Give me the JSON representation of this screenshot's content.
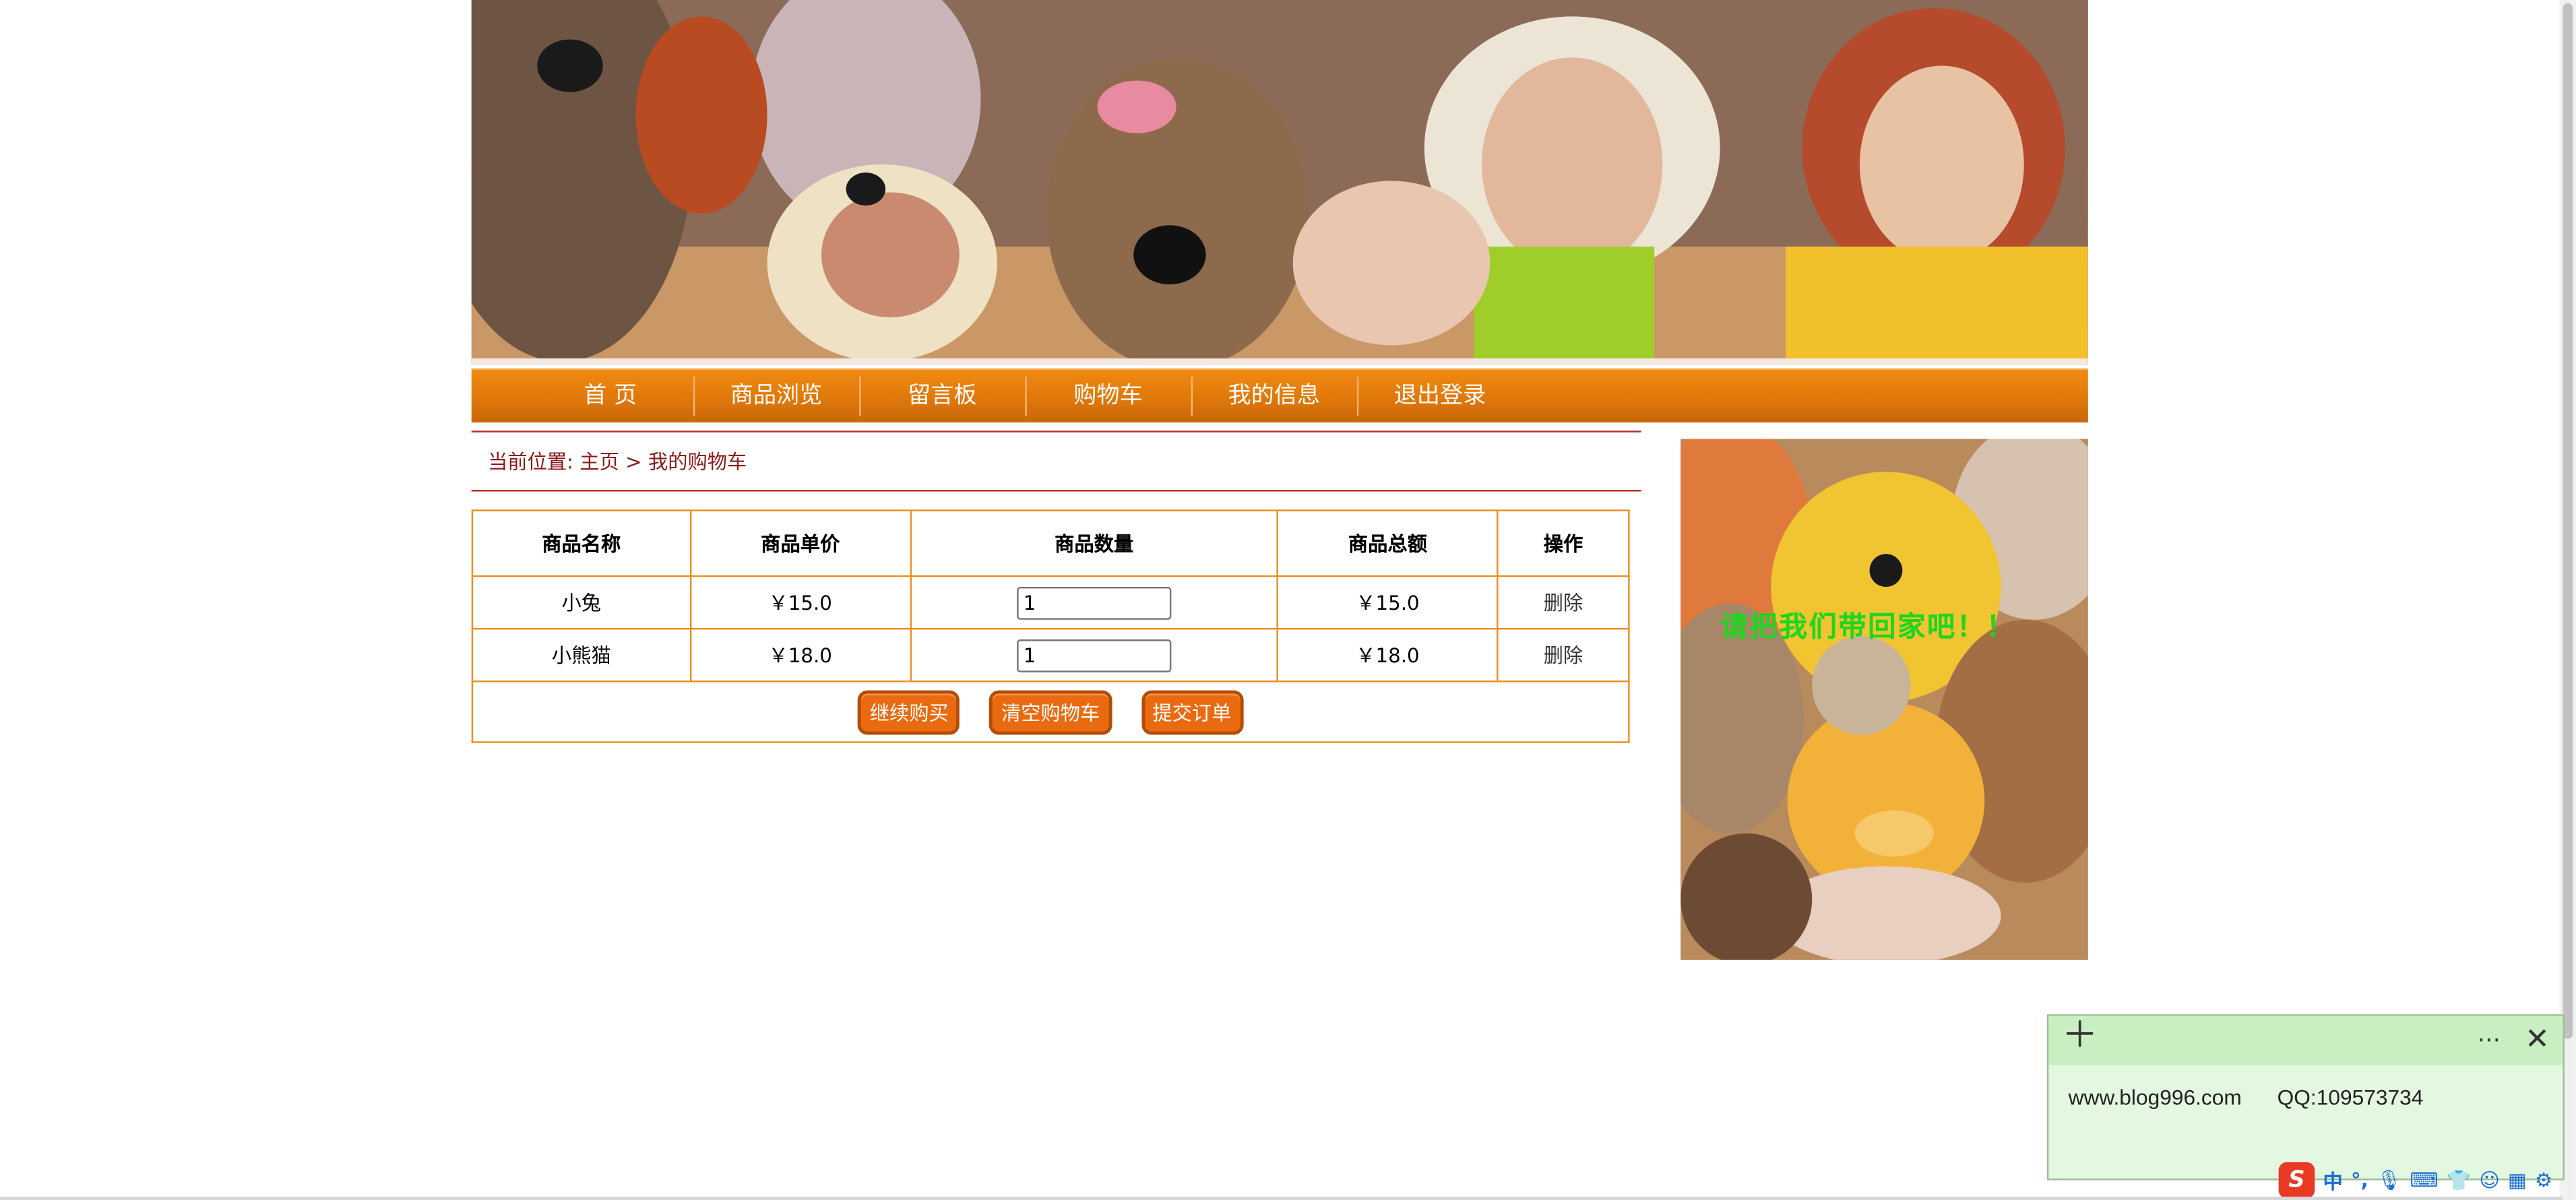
{
  "nav": {
    "items": [
      {
        "label": "首 页"
      },
      {
        "label": "商品浏览"
      },
      {
        "label": "留言板"
      },
      {
        "label": "购物车"
      },
      {
        "label": "我的信息"
      },
      {
        "label": "退出登录"
      }
    ]
  },
  "breadcrumb": {
    "prefix": "当前位置: ",
    "home": "主页",
    "separator": " > ",
    "current": "我的购物车"
  },
  "cart": {
    "headers": [
      "商品名称",
      "商品单价",
      "商品数量",
      "商品总额",
      "操作"
    ],
    "rows": [
      {
        "name": "小兔",
        "price": "￥15.0",
        "qty": "1",
        "total": "￥15.0",
        "action": "删除"
      },
      {
        "name": "小熊猫",
        "price": "￥18.0",
        "qty": "1",
        "total": "￥18.0",
        "action": "删除"
      }
    ],
    "buttons": {
      "continue": "继续购买",
      "clear": "清空购物车",
      "submit": "提交订单"
    }
  },
  "side": {
    "marquee": "请把我们带回家吧！！"
  },
  "note": {
    "text": "www.blog996.com      QQ:109573734"
  },
  "ime": {
    "logo": "S",
    "lang": "中",
    "punct": "°,"
  },
  "colors": {
    "nav_orange": "#e27a0a",
    "border_orange": "#ec8f1f",
    "breadcrumb_red": "#8b1a1a",
    "button_orange": "#ea6a10",
    "marquee_green": "#1fd61f",
    "note_green": "#e4f7e0"
  }
}
